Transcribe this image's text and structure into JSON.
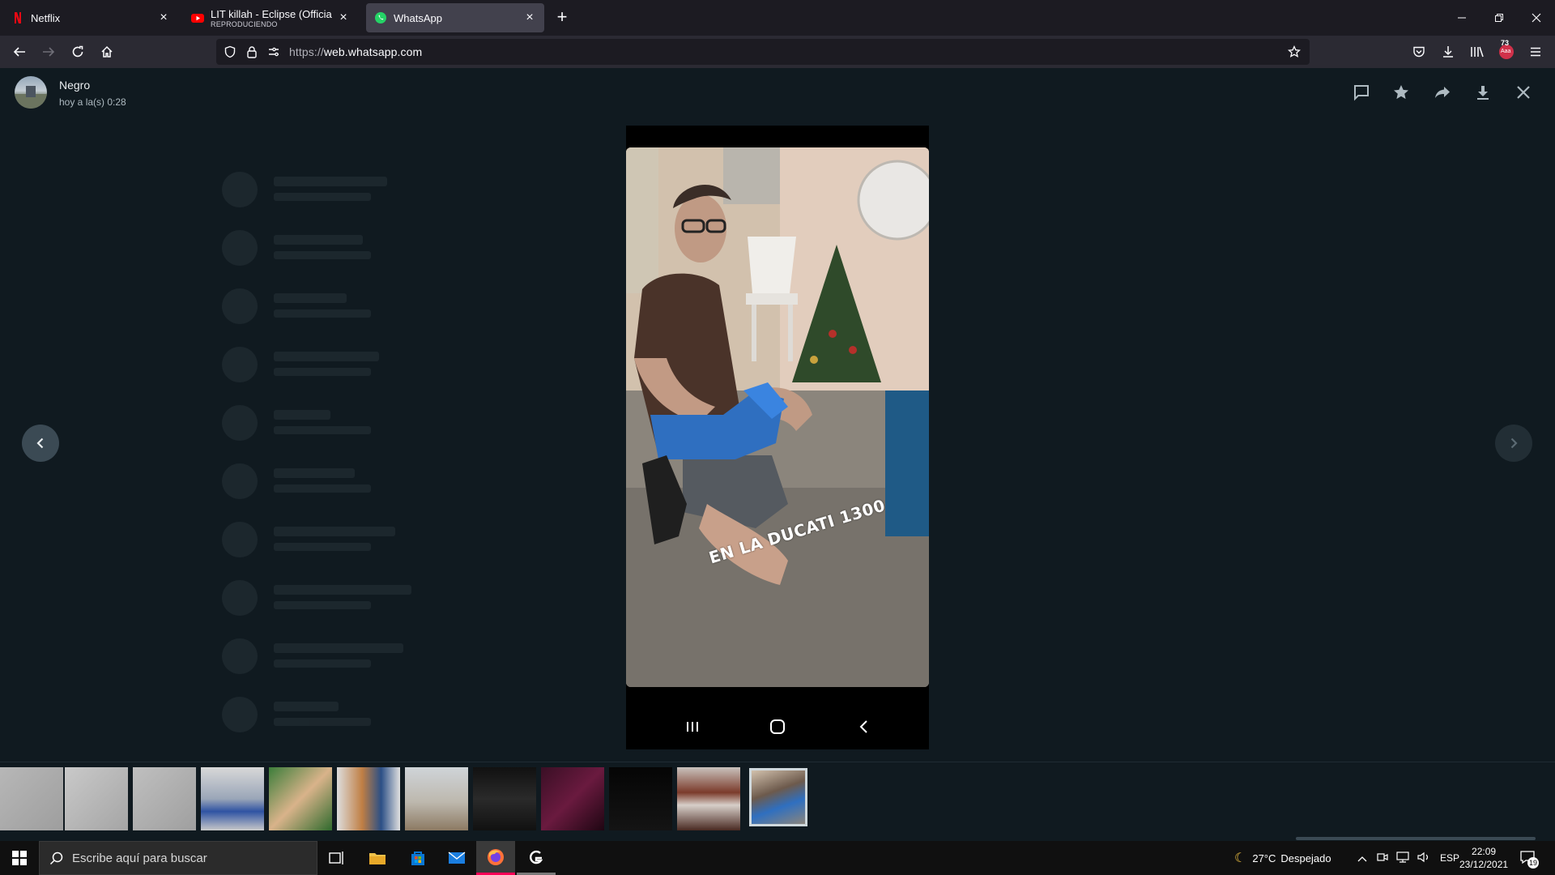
{
  "browser": {
    "tabs": [
      {
        "title": "Netflix",
        "subtitle": "",
        "icon": "netflix-icon",
        "active": false
      },
      {
        "title": "LIT killah - Eclipse (Official Video)",
        "subtitle": "REPRODUCIENDO",
        "icon": "youtube-icon",
        "active": false
      },
      {
        "title": "WhatsApp",
        "subtitle": "",
        "icon": "whatsapp-icon",
        "active": true
      }
    ],
    "url": {
      "prefix": "https://",
      "host": "web.whatsapp.com"
    },
    "library_badge": "73",
    "notifications_badge": "Aaa"
  },
  "viewer": {
    "sender_name": "Negro",
    "timestamp": "hoy a la(s) 0:28",
    "photo_caption": "EN LA DUCATI 1300",
    "header_actions": [
      "reply-icon",
      "star-icon",
      "forward-icon",
      "download-icon",
      "close-icon"
    ],
    "thumbnail_count": 12,
    "selected_thumbnail": 12
  },
  "taskbar": {
    "search_placeholder": "Escribe aquí para buscar",
    "weather": {
      "temp": "27°C",
      "condition": "Despejado"
    },
    "language": "ESP",
    "time": "22:09",
    "date": "23/12/2021",
    "notification_count": "19"
  },
  "colors": {
    "accent": "#00a884",
    "viewer_bg": "#101a20",
    "browser_tabbar": "#1c1b22",
    "browser_navbar": "#2b2a33"
  }
}
